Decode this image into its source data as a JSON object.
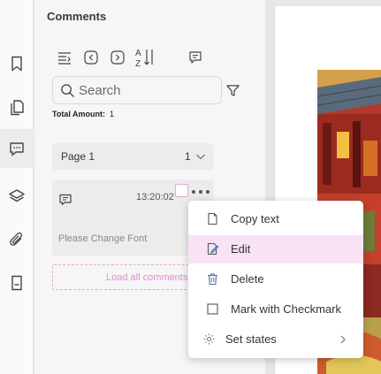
{
  "panel": {
    "title": "Comments",
    "search_placeholder": "Search",
    "total_label": "Total Amount:",
    "total_value": "1",
    "load_all_label": "Load all comments"
  },
  "rail": {
    "items": [
      "bookmark-icon",
      "pages-icon",
      "comments-icon",
      "layers-icon",
      "attachment-icon",
      "form-icon"
    ],
    "active": "comments-icon"
  },
  "toolbar": {
    "icons": [
      "collapse-all-icon",
      "previous-comment-icon",
      "next-comment-icon",
      "sort-az-icon",
      "comment-icon"
    ]
  },
  "page_group": {
    "label": "Page 1",
    "count": "1"
  },
  "comment": {
    "time": "13:20:02",
    "text": "Please Change Font"
  },
  "context_menu": {
    "items": [
      {
        "label": "Copy text",
        "icon": "copy-icon"
      },
      {
        "label": "Edit",
        "icon": "edit-icon",
        "highlighted": true
      },
      {
        "label": "Delete",
        "icon": "trash-icon"
      },
      {
        "label": "Mark with Checkmark",
        "icon": "checkbox-icon"
      },
      {
        "label": "Set states",
        "icon": "gear-icon",
        "submenu": true
      }
    ]
  },
  "colors": {
    "accent": "#e08bd3",
    "highlight": "#f8e2f4",
    "panel_bg": "#f6f6f6"
  }
}
